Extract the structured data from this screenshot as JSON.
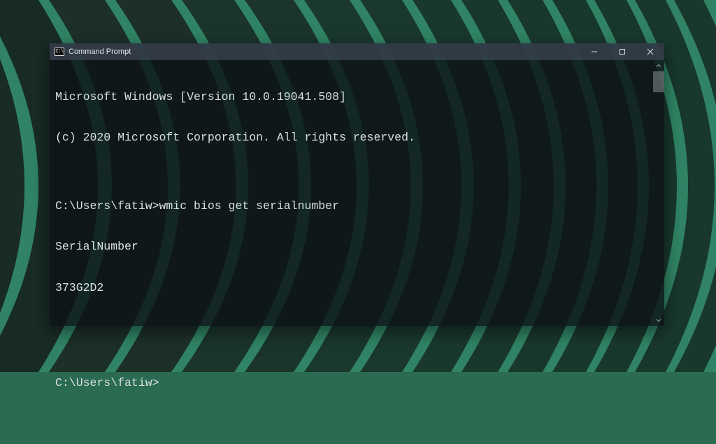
{
  "window": {
    "title": "Command Prompt",
    "icon_glyph": "C:\\"
  },
  "terminal": {
    "banner_line1": "Microsoft Windows [Version 10.0.19041.508]",
    "banner_line2": "(c) 2020 Microsoft Corporation. All rights reserved.",
    "blank": "",
    "prompt1_prefix": "C:\\Users\\fatiw>",
    "prompt1_command": "wmic bios get serialnumber",
    "output_header": "SerialNumber",
    "output_value": "373G2D2",
    "prompt2_prefix": "C:\\Users\\fatiw>"
  }
}
